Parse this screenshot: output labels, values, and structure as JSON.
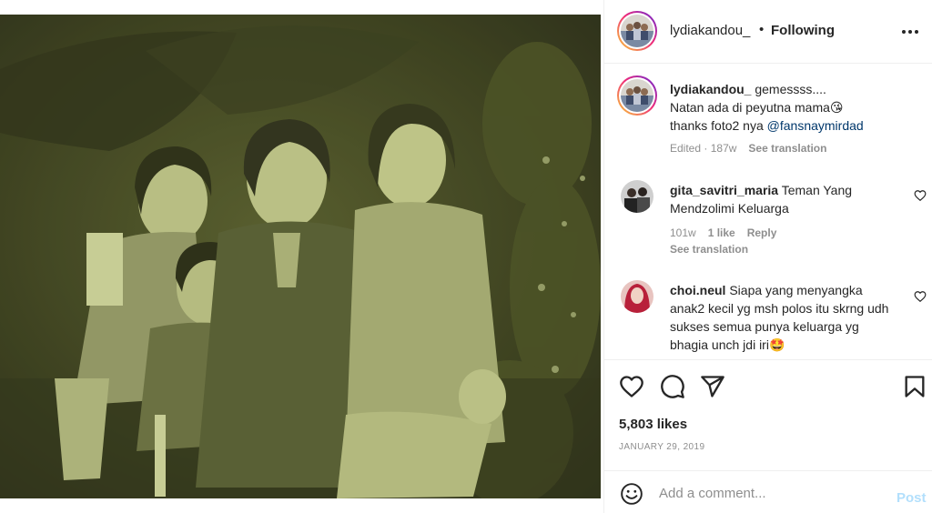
{
  "post": {
    "author": "lydiakandou_",
    "separator": "•",
    "follow_status": "Following",
    "image_alt": "Sepia family photo"
  },
  "caption": {
    "username": "lydiakandou_",
    "text_line1": "gemessss....",
    "text_line2": "Natan ada di peyutna mama😘",
    "text_line3_prefix": "thanks foto2 nya ",
    "mention": "@fansnaymirdad",
    "edited": "Edited",
    "dot": "·",
    "age": "187w",
    "translate": "See translation"
  },
  "comments": [
    {
      "username": "gita_savitri_maria",
      "text": "Teman Yang Mendzolimi Keluarga",
      "age": "101w",
      "likes": "1 like",
      "reply": "Reply",
      "translate": "See translation"
    },
    {
      "username": "choi.neul",
      "text": "Siapa yang menyangka anak2 kecil yg msh polos itu skrng udh sukses semua punya keluarga yg bhagia unch jdi iri🤩"
    }
  ],
  "actions": {
    "like_icon": "heart-icon",
    "comment_icon": "comment-icon",
    "share_icon": "send-icon",
    "save_icon": "bookmark-icon"
  },
  "likes": "5,803 likes",
  "date": "JANUARY 29, 2019",
  "composer": {
    "placeholder": "Add a comment...",
    "post_label": "Post",
    "emoji_icon": "smiley-icon"
  },
  "colors": {
    "link": "#00376b",
    "post_disabled": "#b2dffc",
    "muted": "#8e8e8e",
    "photo_tint": "#c4c98e"
  }
}
